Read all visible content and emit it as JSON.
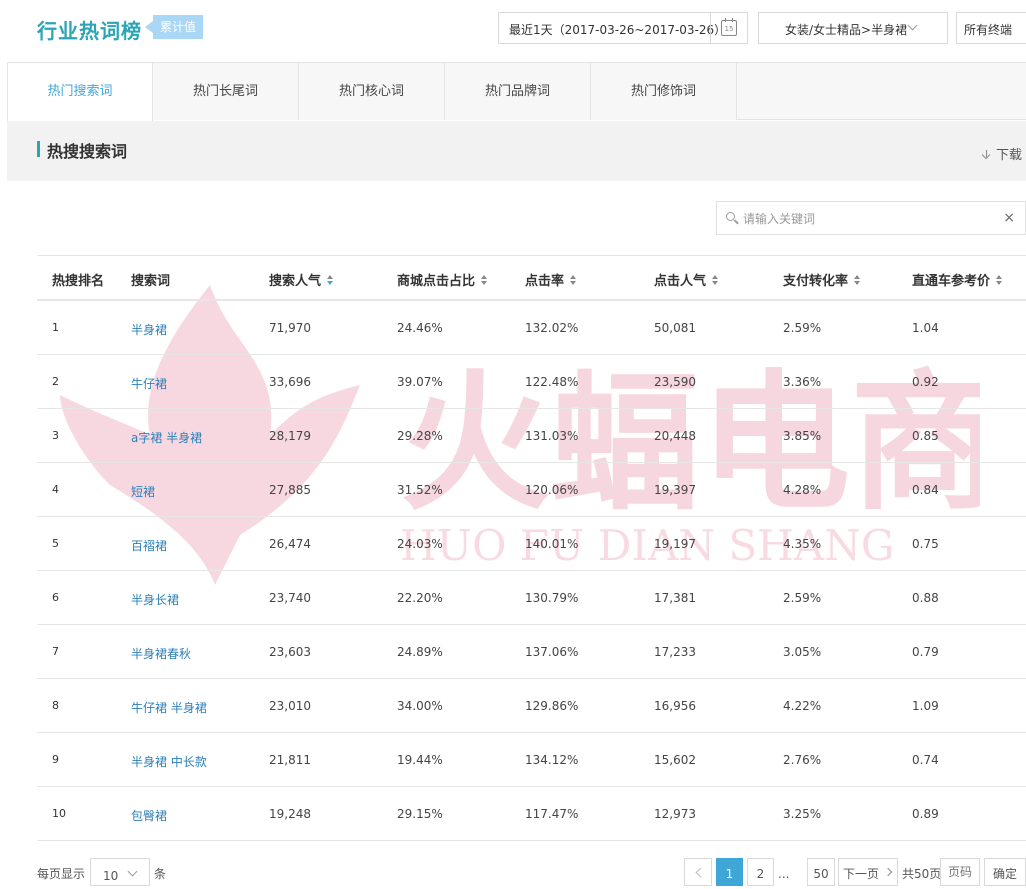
{
  "header": {
    "title": "行业热词榜",
    "badge": "累计值",
    "date_range": "最近1天（2017-03-26~2017-03-26）",
    "calendar_day": "15",
    "category": "女装/女士精品>半身裙",
    "terminal": "所有终端"
  },
  "tabs": [
    {
      "label": "热门搜索词",
      "active": true
    },
    {
      "label": "热门长尾词",
      "active": false
    },
    {
      "label": "热门核心词",
      "active": false
    },
    {
      "label": "热门品牌词",
      "active": false
    },
    {
      "label": "热门修饰词",
      "active": false
    }
  ],
  "section": {
    "title": "热搜搜索词",
    "download_label": "下载"
  },
  "search": {
    "placeholder": "请输入关键词",
    "value": "",
    "clear": "×"
  },
  "table": {
    "columns": [
      "热搜排名",
      "搜索词",
      "搜索人气",
      "商城点击占比",
      "点击率",
      "点击人气",
      "支付转化率",
      "直通车参考价"
    ],
    "sorted_column": "搜索人气",
    "rows": [
      {
        "rank": "1",
        "keyword": "半身裙",
        "search_pop": "71,970",
        "mall_click": "24.46%",
        "ctr": "132.02%",
        "click_pop": "50,081",
        "pay_conv": "2.59%",
        "ztc_price": "1.04"
      },
      {
        "rank": "2",
        "keyword": "牛仔裙",
        "search_pop": "33,696",
        "mall_click": "39.07%",
        "ctr": "122.48%",
        "click_pop": "23,590",
        "pay_conv": "3.36%",
        "ztc_price": "0.92"
      },
      {
        "rank": "3",
        "keyword": "a字裙 半身裙",
        "search_pop": "28,179",
        "mall_click": "29.28%",
        "ctr": "131.03%",
        "click_pop": "20,448",
        "pay_conv": "3.85%",
        "ztc_price": "0.85"
      },
      {
        "rank": "4",
        "keyword": "短裙",
        "search_pop": "27,885",
        "mall_click": "31.52%",
        "ctr": "120.06%",
        "click_pop": "19,397",
        "pay_conv": "4.28%",
        "ztc_price": "0.84"
      },
      {
        "rank": "5",
        "keyword": "百褶裙",
        "search_pop": "26,474",
        "mall_click": "24.03%",
        "ctr": "140.01%",
        "click_pop": "19,197",
        "pay_conv": "4.35%",
        "ztc_price": "0.75"
      },
      {
        "rank": "6",
        "keyword": "半身长裙",
        "search_pop": "23,740",
        "mall_click": "22.20%",
        "ctr": "130.79%",
        "click_pop": "17,381",
        "pay_conv": "2.59%",
        "ztc_price": "0.88"
      },
      {
        "rank": "7",
        "keyword": "半身裙春秋",
        "search_pop": "23,603",
        "mall_click": "24.89%",
        "ctr": "137.06%",
        "click_pop": "17,233",
        "pay_conv": "3.05%",
        "ztc_price": "0.79"
      },
      {
        "rank": "8",
        "keyword": "牛仔裙 半身裙",
        "search_pop": "23,010",
        "mall_click": "34.00%",
        "ctr": "129.86%",
        "click_pop": "16,956",
        "pay_conv": "4.22%",
        "ztc_price": "1.09"
      },
      {
        "rank": "9",
        "keyword": "半身裙 中长款",
        "search_pop": "21,811",
        "mall_click": "19.44%",
        "ctr": "134.12%",
        "click_pop": "15,602",
        "pay_conv": "2.76%",
        "ztc_price": "0.74"
      },
      {
        "rank": "10",
        "keyword": "包臀裙",
        "search_pop": "19,248",
        "mall_click": "29.15%",
        "ctr": "117.47%",
        "click_pop": "12,973",
        "pay_conv": "3.25%",
        "ztc_price": "0.89"
      }
    ]
  },
  "watermark": {
    "brand": "火蝠电商",
    "latin": "HUO FU DIAN SHANG",
    "color": "#f2b8c6"
  },
  "pagination": {
    "per_page_label": "每页显示",
    "per_page_value": "10",
    "per_page_unit": "条",
    "current_page": "1",
    "page_2": "2",
    "ellipsis": "...",
    "last_page": "50",
    "next_label": "下一页",
    "total_label": "共50页",
    "page_input_placeholder": "页码",
    "confirm_label": "确定"
  },
  "colors": {
    "title": "#2aa4b6",
    "active_tab": "#3fa7d8",
    "keyword_link": "#2c7fb8",
    "badge": "#a9d7f5"
  }
}
